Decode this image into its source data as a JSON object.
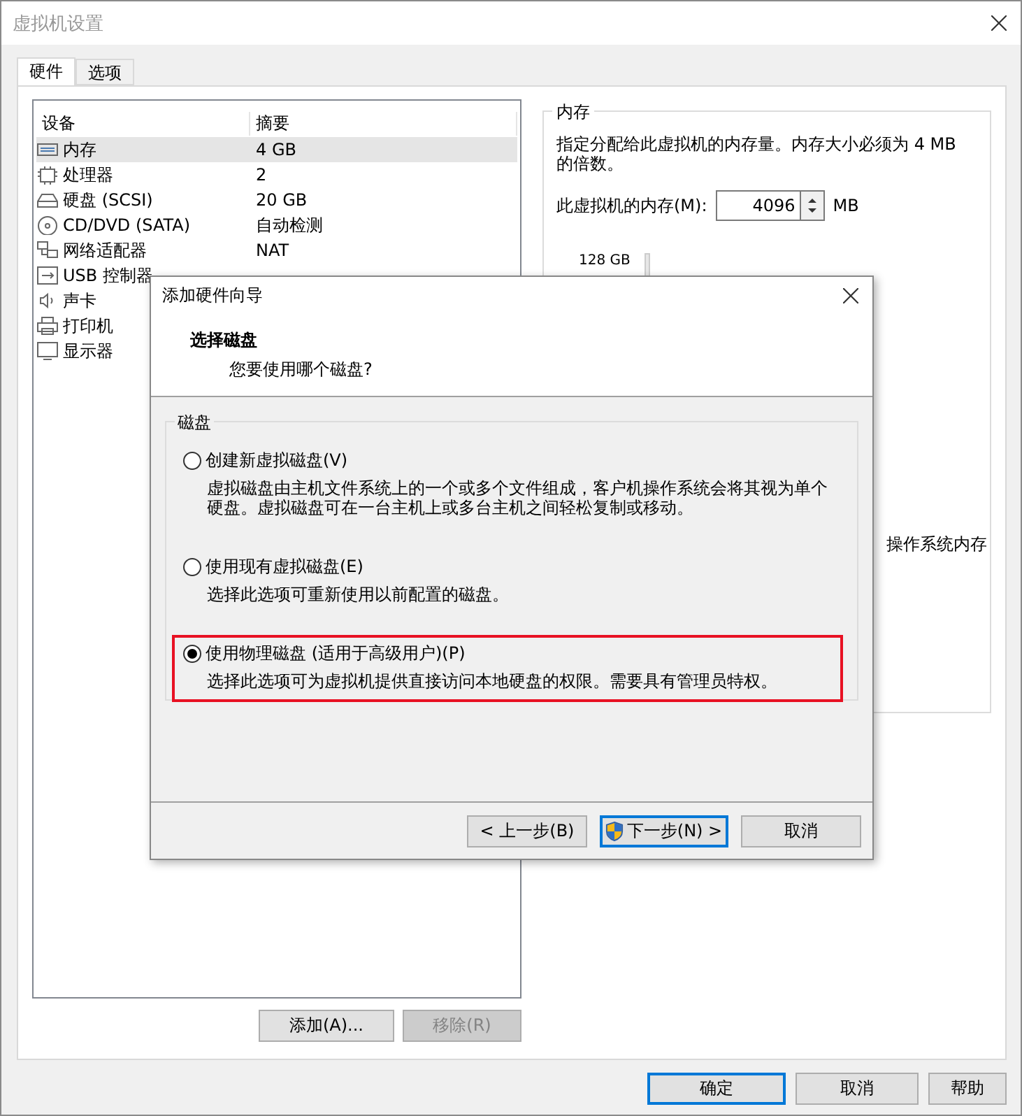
{
  "window": {
    "title": "虚拟机设置"
  },
  "tabs": [
    {
      "label": "硬件",
      "selected": true
    },
    {
      "label": "选项",
      "selected": false
    }
  ],
  "device_table": {
    "columns": [
      "设备",
      "摘要"
    ],
    "rows": [
      {
        "kind": "memory",
        "device": "内存",
        "summary": "4 GB",
        "selected": true
      },
      {
        "kind": "cpu",
        "device": "处理器",
        "summary": "2",
        "selected": false
      },
      {
        "kind": "disk",
        "device": "硬盘 (SCSI)",
        "summary": "20 GB",
        "selected": false
      },
      {
        "kind": "cd",
        "device": "CD/DVD (SATA)",
        "summary": "自动检测",
        "selected": false
      },
      {
        "kind": "network",
        "device": "网络适配器",
        "summary": "NAT",
        "selected": false
      },
      {
        "kind": "usb",
        "device": "USB 控制器",
        "selected": false
      },
      {
        "kind": "sound",
        "device": "声卡",
        "selected": false
      },
      {
        "kind": "printer",
        "device": "打印机",
        "selected": false
      },
      {
        "kind": "display",
        "device": "显示器",
        "selected": false
      }
    ]
  },
  "memory_panel": {
    "title": "内存",
    "description": "指定分配给此虚拟机的内存量。内存大小必须为 4 MB 的倍数。",
    "field_label": "此虚拟机的内存(M):",
    "value": "4096",
    "unit": "MB",
    "scale_label": "128 GB",
    "note_fragment": "操作系统内存"
  },
  "list_buttons": [
    {
      "label": "添加(A)...",
      "disabled": false
    },
    {
      "label": "移除(R)",
      "disabled": true
    }
  ],
  "footer_buttons": [
    {
      "label": "确定",
      "default": true
    },
    {
      "label": "取消",
      "default": false
    },
    {
      "label": "帮助",
      "default": false
    }
  ],
  "dialog": {
    "title": "添加硬件向导",
    "heading": "选择磁盘",
    "subheading": "您要使用哪个磁盘?",
    "group": "磁盘",
    "options": [
      {
        "label": "创建新虚拟磁盘(V)",
        "description": "虚拟磁盘由主机文件系统上的一个或多个文件组成，客户机操作系统会将其视为单个硬盘。虚拟磁盘可在一台主机上或多台主机之间轻松复制或移动。",
        "selected": false,
        "highlighted": false
      },
      {
        "label": "使用现有虚拟磁盘(E)",
        "description": "选择此选项可重新使用以前配置的磁盘。",
        "selected": false,
        "highlighted": false
      },
      {
        "label": "使用物理磁盘 (适用于高级用户)(P)",
        "description": "选择此选项可为虚拟机提供直接访问本地硬盘的权限。需要具有管理员特权。",
        "selected": true,
        "highlighted": true
      }
    ],
    "buttons": [
      {
        "label": "< 上一步(B)",
        "shield": false,
        "default": false
      },
      {
        "label": "下一步(N) >",
        "shield": true,
        "default": true
      },
      {
        "label": "取消",
        "shield": false,
        "default": false
      }
    ]
  }
}
